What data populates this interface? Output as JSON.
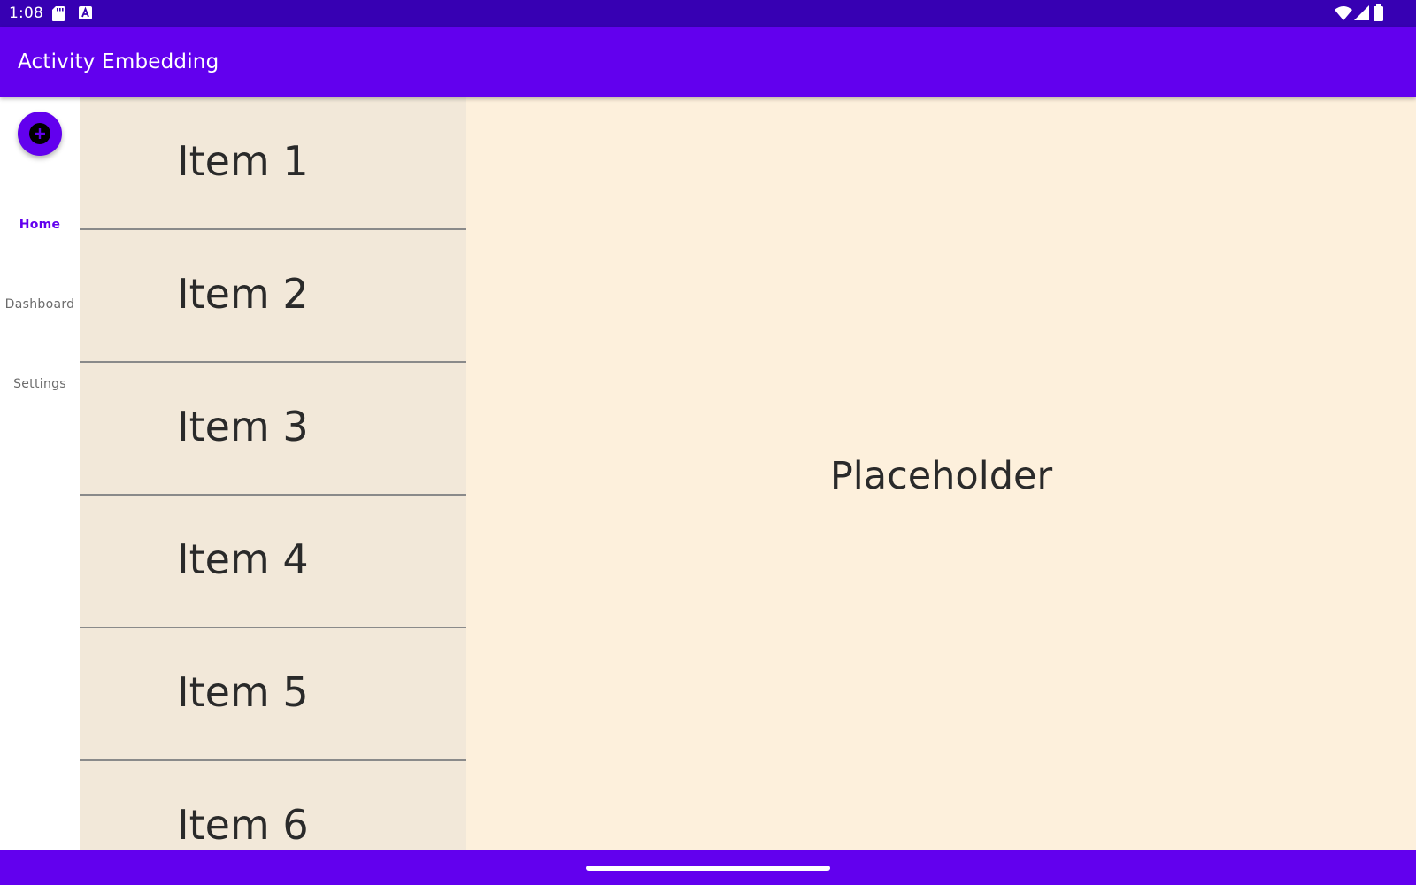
{
  "status_bar": {
    "time": "1:08",
    "left_icons": [
      "sd-card-icon",
      "app-notification-icon"
    ],
    "right_icons": [
      "wifi-icon",
      "cell-signal-icon",
      "battery-icon"
    ]
  },
  "app_bar": {
    "title": "Activity Embedding"
  },
  "nav_rail": {
    "fab_icon": "add-circle-icon",
    "items": [
      {
        "label": "Home",
        "active": true
      },
      {
        "label": "Dashboard",
        "active": false
      },
      {
        "label": "Settings",
        "active": false
      }
    ]
  },
  "list": {
    "items": [
      {
        "label": "Item 1"
      },
      {
        "label": "Item 2"
      },
      {
        "label": "Item 3"
      },
      {
        "label": "Item 4"
      },
      {
        "label": "Item 5"
      },
      {
        "label": "Item 6"
      }
    ]
  },
  "detail": {
    "placeholder": "Placeholder"
  },
  "colors": {
    "status_bar": "#3700b3",
    "primary": "#6200ee",
    "list_background": "#f2e8d9",
    "detail_background": "#fdf0dc",
    "text": "#2a2a2a"
  }
}
